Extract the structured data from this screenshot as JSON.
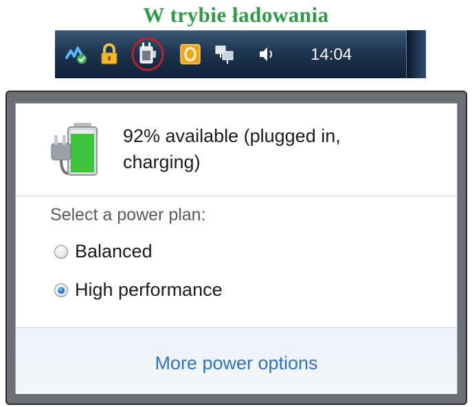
{
  "caption": "W trybie ładowania",
  "taskbar": {
    "icons": [
      "network-activity-icon",
      "lock-icon",
      "power-plug-icon",
      "outlook-icon",
      "network-icon",
      "speaker-icon"
    ],
    "clock": "14:04"
  },
  "battery_popup": {
    "status": "92% available (plugged in, charging)",
    "charge_level": 0.92,
    "plan_heading": "Select a power plan:",
    "plans": [
      {
        "label": "Balanced",
        "selected": false
      },
      {
        "label": "High performance",
        "selected": true
      }
    ],
    "more_link": "More power options"
  },
  "colors": {
    "caption": "#2e9a46",
    "taskbar": "#1d3550",
    "link": "#2f72c4",
    "highlight_circle": "#c0202a"
  }
}
